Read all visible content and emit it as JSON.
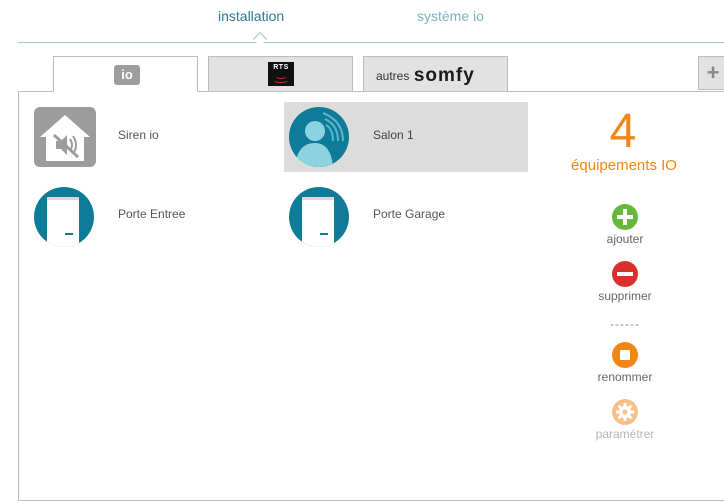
{
  "top_nav": {
    "tabs": [
      {
        "label": "installation",
        "active": true
      },
      {
        "label": "système io",
        "active": false
      }
    ]
  },
  "protocol_tabs": {
    "io_label": "io",
    "rts_label": "RTS",
    "somfy_prefix": "autres",
    "somfy_brand": "somfy",
    "add_label": "+"
  },
  "devices": [
    {
      "name": "Siren io",
      "icon": "siren-muted-icon"
    },
    {
      "name": "Salon 1",
      "icon": "user-profile-icon",
      "selected": true
    },
    {
      "name": "Porte Entree",
      "icon": "door-icon"
    },
    {
      "name": "Porte Garage",
      "icon": "door-icon"
    }
  ],
  "summary": {
    "count": "4",
    "label": "équipements IO"
  },
  "actions": {
    "add": {
      "label": "ajouter",
      "icon": "plus-icon",
      "color": "#67b83a"
    },
    "delete": {
      "label": "supprimer",
      "icon": "minus-icon",
      "color": "#d9302c"
    },
    "separator": "------",
    "rename": {
      "label": "renommer",
      "icon": "stop-icon",
      "color": "#f08616"
    },
    "settings": {
      "label": "paramétrer",
      "icon": "gear-icon",
      "color": "#f7c088",
      "disabled": true
    }
  },
  "colors": {
    "accent": "#f08616",
    "nav_active": "#2d7b96",
    "nav_inactive": "#7ab3c6",
    "device_teal": "#0e7c98"
  }
}
